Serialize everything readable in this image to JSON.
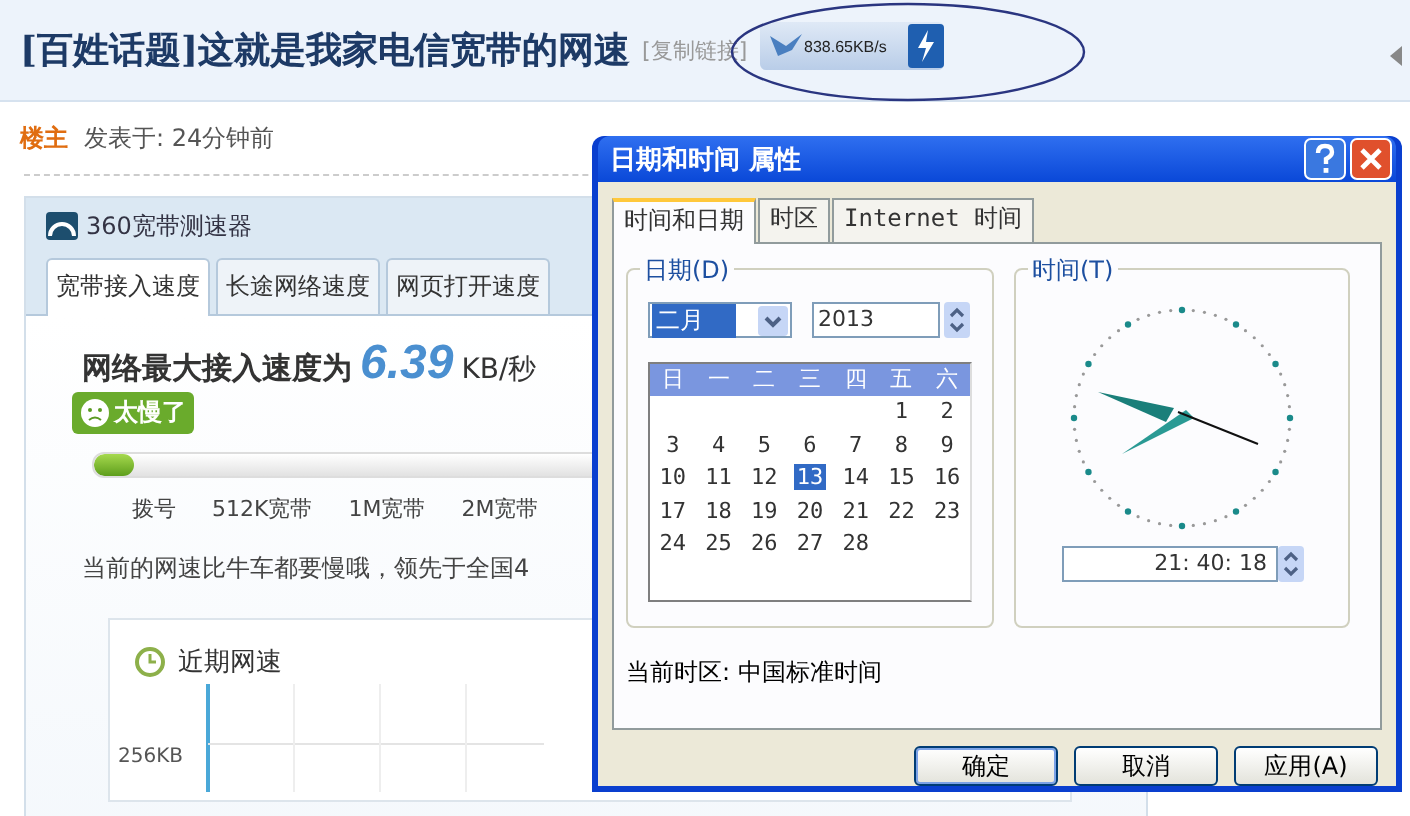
{
  "post": {
    "title": "[百姓话题]这就是我家电信宽带的网速",
    "copy_link": "[复制链接]",
    "speed_reading": "838.65KB/s",
    "author_label": "楼主",
    "posted": "发表于: 24分钟前"
  },
  "speed_test": {
    "app_name": "360宽带测速器",
    "tabs": [
      {
        "label": "宽带接入速度",
        "selected": true
      },
      {
        "label": "长途网络速度",
        "selected": false
      },
      {
        "label": "网页打开速度",
        "selected": false
      }
    ],
    "result_prefix": "网络最大接入速度为",
    "result_value": "6.39",
    "result_unit": "KB/秒",
    "badge": "太慢了",
    "level": 0.04,
    "scale": [
      "拨号",
      "512K宽带",
      "1M宽带",
      "2M宽带"
    ],
    "comment": "当前的网速比牛车都要慢哦，领先于全国4",
    "history": {
      "title": "近期网速",
      "axis_label": "256KB"
    }
  },
  "dialog": {
    "title": "日期和时间 属性",
    "tabs": [
      {
        "label": "时间和日期",
        "selected": true
      },
      {
        "label": "时区",
        "selected": false
      },
      {
        "label": "Internet 时间",
        "selected": false
      }
    ],
    "date_group": "日期(D)",
    "month": "二月",
    "year": "2013",
    "weekdays": [
      "日",
      "一",
      "二",
      "三",
      "四",
      "五",
      "六"
    ],
    "weeks": [
      [
        {
          "day": "1",
          "selected": false
        },
        {
          "day": "2",
          "selected": false
        }
      ],
      [
        {
          "day": "3",
          "selected": false
        },
        {
          "day": "4",
          "selected": false
        },
        {
          "day": "5",
          "selected": false
        },
        {
          "day": "6",
          "selected": false
        },
        {
          "day": "7",
          "selected": false
        },
        {
          "day": "8",
          "selected": false
        },
        {
          "day": "9",
          "selected": false
        }
      ],
      [
        {
          "day": "10",
          "selected": false
        },
        {
          "day": "11",
          "selected": false
        },
        {
          "day": "12",
          "selected": false
        },
        {
          "day": "13",
          "selected": true
        },
        {
          "day": "14",
          "selected": false
        },
        {
          "day": "15",
          "selected": false
        },
        {
          "day": "16",
          "selected": false
        }
      ],
      [
        {
          "day": "17",
          "selected": false
        },
        {
          "day": "18",
          "selected": false
        },
        {
          "day": "19",
          "selected": false
        },
        {
          "day": "20",
          "selected": false
        },
        {
          "day": "21",
          "selected": false
        },
        {
          "day": "22",
          "selected": false
        },
        {
          "day": "23",
          "selected": false
        }
      ],
      [
        {
          "day": "24",
          "selected": false
        },
        {
          "day": "25",
          "selected": false
        },
        {
          "day": "26",
          "selected": false
        },
        {
          "day": "27",
          "selected": false
        },
        {
          "day": "28",
          "selected": false
        }
      ]
    ],
    "time_group": "时间(T)",
    "time": "21: 40: 18",
    "timezone": "当前时区: 中国标准时间",
    "buttons": [
      "确定",
      "取消",
      "应用(A)"
    ]
  }
}
